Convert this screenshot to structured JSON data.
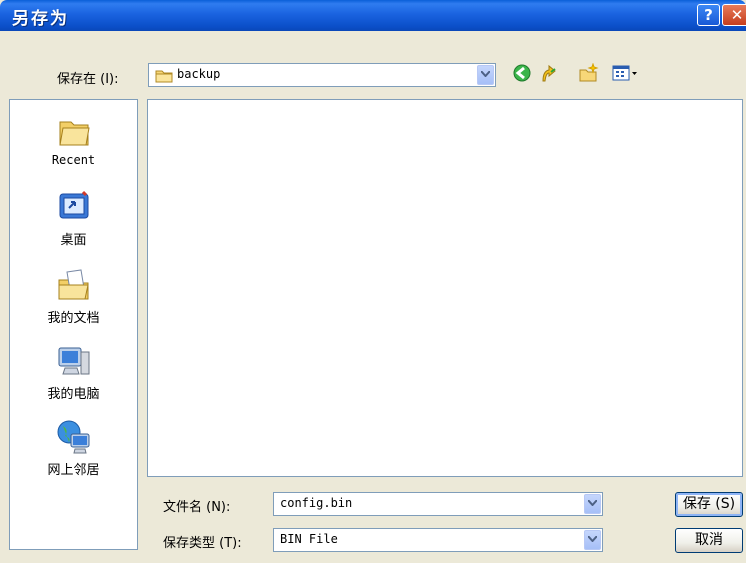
{
  "window": {
    "title": "另存为",
    "help_icon": "?",
    "close_icon": "✕"
  },
  "save_in": {
    "label": "保存在 (I):",
    "value": "backup"
  },
  "places": [
    {
      "label": "Recent",
      "icon": "recent-folder-icon"
    },
    {
      "label": "桌面",
      "icon": "desktop-icon"
    },
    {
      "label": "我的文档",
      "icon": "my-documents-icon"
    },
    {
      "label": "我的电脑",
      "icon": "my-computer-icon"
    },
    {
      "label": "网上邻居",
      "icon": "network-places-icon"
    }
  ],
  "filename": {
    "label": "文件名 (N):",
    "value": "config.bin"
  },
  "filetype": {
    "label": "保存类型 (T):",
    "value": "BIN File"
  },
  "buttons": {
    "save": "保存 (S)",
    "cancel": "取消"
  },
  "colors": {
    "title_blue": "#0b4fc9",
    "dialog_bg": "#ece9d8",
    "close_red": "#c53d1d"
  }
}
